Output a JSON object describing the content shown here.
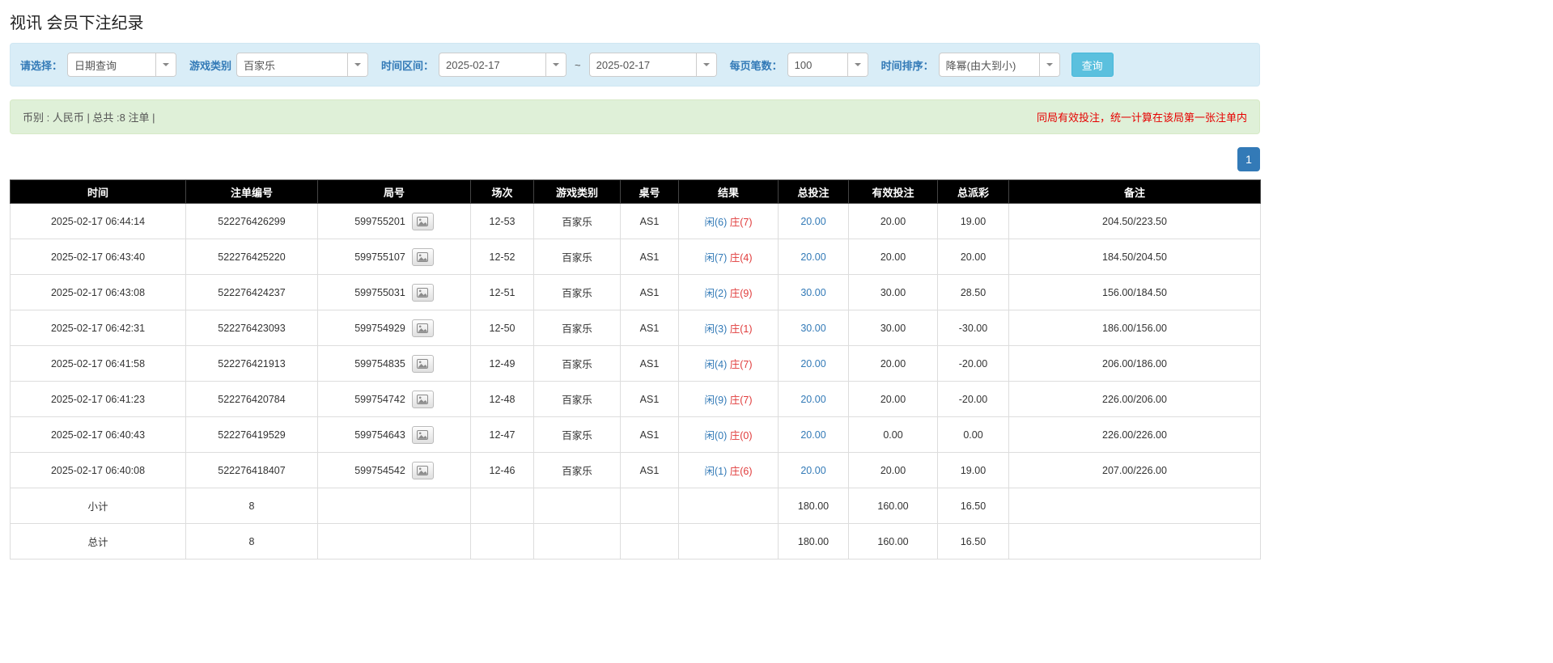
{
  "page": {
    "title": "视讯 会员下注纪录"
  },
  "filters": {
    "query_type_label": "请选择：",
    "query_type_value": "日期查询",
    "game_type_label": "游戏类别",
    "game_type_value": "百家乐",
    "time_range_label": "时间区间：",
    "date_from": "2025-02-17",
    "range_separator": "~",
    "date_to": "2025-02-17",
    "page_size_label": "每页笔数：",
    "page_size_value": "100",
    "sort_label": "时间排序：",
    "sort_value": "降幂(由大到小)",
    "search_button": "查询"
  },
  "summary": {
    "left_text": "币别 : 人民币 | 总共 :8 注单 |",
    "right_text": "同局有效投注，统一计算在该局第一张注单内"
  },
  "pagination": {
    "current_page": "1"
  },
  "table": {
    "headers": [
      "时间",
      "注单编号",
      "局号",
      "场次",
      "游戏类别",
      "桌号",
      "结果",
      "总投注",
      "有效投注",
      "总派彩",
      "备注"
    ],
    "rows": [
      {
        "time": "2025-02-17 06:44:14",
        "bet_id": "522276426299",
        "round_id": "599755201",
        "session": "12-53",
        "game": "百家乐",
        "table_no": "AS1",
        "result_player": "闲(6)",
        "result_banker": "庄(7)",
        "total_bet": "20.00",
        "valid_bet": "20.00",
        "payout": "19.00",
        "remark": "204.50/223.50"
      },
      {
        "time": "2025-02-17 06:43:40",
        "bet_id": "522276425220",
        "round_id": "599755107",
        "session": "12-52",
        "game": "百家乐",
        "table_no": "AS1",
        "result_player": "闲(7)",
        "result_banker": "庄(4)",
        "total_bet": "20.00",
        "valid_bet": "20.00",
        "payout": "20.00",
        "remark": "184.50/204.50"
      },
      {
        "time": "2025-02-17 06:43:08",
        "bet_id": "522276424237",
        "round_id": "599755031",
        "session": "12-51",
        "game": "百家乐",
        "table_no": "AS1",
        "result_player": "闲(2)",
        "result_banker": "庄(9)",
        "total_bet": "30.00",
        "valid_bet": "30.00",
        "payout": "28.50",
        "remark": "156.00/184.50"
      },
      {
        "time": "2025-02-17 06:42:31",
        "bet_id": "522276423093",
        "round_id": "599754929",
        "session": "12-50",
        "game": "百家乐",
        "table_no": "AS1",
        "result_player": "闲(3)",
        "result_banker": "庄(1)",
        "total_bet": "30.00",
        "valid_bet": "30.00",
        "payout": "-30.00",
        "remark": "186.00/156.00"
      },
      {
        "time": "2025-02-17 06:41:58",
        "bet_id": "522276421913",
        "round_id": "599754835",
        "session": "12-49",
        "game": "百家乐",
        "table_no": "AS1",
        "result_player": "闲(4)",
        "result_banker": "庄(7)",
        "total_bet": "20.00",
        "valid_bet": "20.00",
        "payout": "-20.00",
        "remark": "206.00/186.00"
      },
      {
        "time": "2025-02-17 06:41:23",
        "bet_id": "522276420784",
        "round_id": "599754742",
        "session": "12-48",
        "game": "百家乐",
        "table_no": "AS1",
        "result_player": "闲(9)",
        "result_banker": "庄(7)",
        "total_bet": "20.00",
        "valid_bet": "20.00",
        "payout": "-20.00",
        "remark": "226.00/206.00"
      },
      {
        "time": "2025-02-17 06:40:43",
        "bet_id": "522276419529",
        "round_id": "599754643",
        "session": "12-47",
        "game": "百家乐",
        "table_no": "AS1",
        "result_player": "闲(0)",
        "result_banker": "庄(0)",
        "total_bet": "20.00",
        "valid_bet": "0.00",
        "payout": "0.00",
        "remark": "226.00/226.00"
      },
      {
        "time": "2025-02-17 06:40:08",
        "bet_id": "522276418407",
        "round_id": "599754542",
        "session": "12-46",
        "game": "百家乐",
        "table_no": "AS1",
        "result_player": "闲(1)",
        "result_banker": "庄(6)",
        "total_bet": "20.00",
        "valid_bet": "20.00",
        "payout": "19.00",
        "remark": "207.00/226.00"
      }
    ],
    "subtotal": {
      "label": "小计",
      "count": "8",
      "total_bet": "180.00",
      "valid_bet": "160.00",
      "payout": "16.50"
    },
    "total": {
      "label": "总计",
      "count": "8",
      "total_bet": "180.00",
      "valid_bet": "160.00",
      "payout": "16.50"
    }
  },
  "colors": {
    "accent_blue": "#337ab7",
    "filter_bar_bg": "#d9edf7",
    "summary_bar_bg": "#dff0d8",
    "danger_red": "#e03b3b",
    "notice_red": "#e60000",
    "table_header_bg": "#000000",
    "footer_row_gray": "#848484",
    "search_button_bg": "#5bc0de"
  }
}
